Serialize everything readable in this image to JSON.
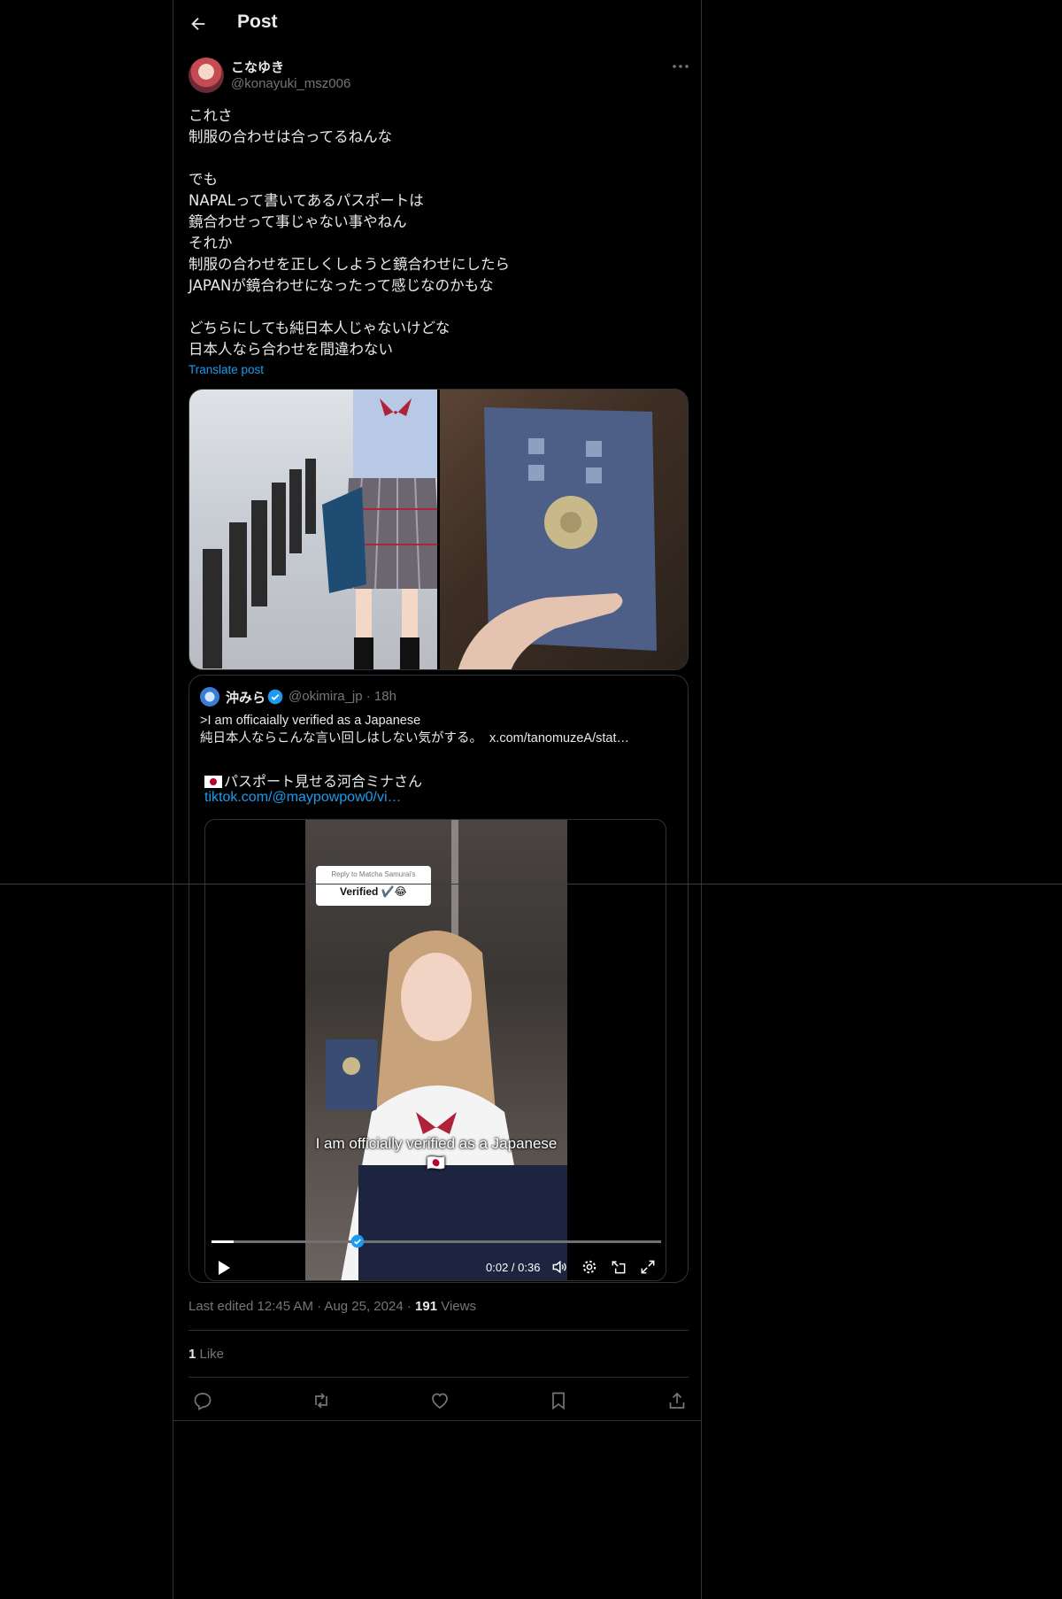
{
  "header": {
    "title": "Post"
  },
  "author": {
    "name": "こなゆき",
    "handle": "@konayuki_msz006"
  },
  "post": {
    "text": "これさ\n制服の合わせは合ってるねんな\n\nでも\nNAPALって書いてあるパスポートは\n鏡合わせって事じゃない事やねん\nそれか\n制服の合わせを正しくしようと鏡合わせにしたら\nJAPANが鏡合わせになったって感じなのかもな\n\nどちらにしても純日本人じゃないけどな\n日本人なら合わせを間違わない",
    "translate_label": "Translate post"
  },
  "quote": {
    "name": "沖みら",
    "handle": "@okimira_jp",
    "time": "· 18h",
    "text": ">I am officaially verified as a Japanese\n純日本人ならこんな言い回しはしない気がする。  x.com/tanomuzeA/stat…",
    "embed": {
      "title": "パスポート見せる河合ミナさん",
      "link": "tiktok.com/@maypowpow0/vi…",
      "video": {
        "reply_to": "Reply to Matcha Samurai's",
        "reply_text": "Verified ✔️😂",
        "subtitle": "I am officially verified as a Japanese 🇯🇵",
        "time": "0:02 / 0:36",
        "progress": 0.05
      }
    }
  },
  "meta": {
    "edited": "Last edited 12:45 AM · Aug 25, 2024 · ",
    "views_count": "191",
    "views_label": " Views"
  },
  "likes": {
    "count": "1",
    "label": " Like"
  },
  "colors": {
    "accent": "#1d9bf0",
    "muted": "#71767b",
    "text": "#e7e9ea",
    "border": "#2f3336"
  }
}
